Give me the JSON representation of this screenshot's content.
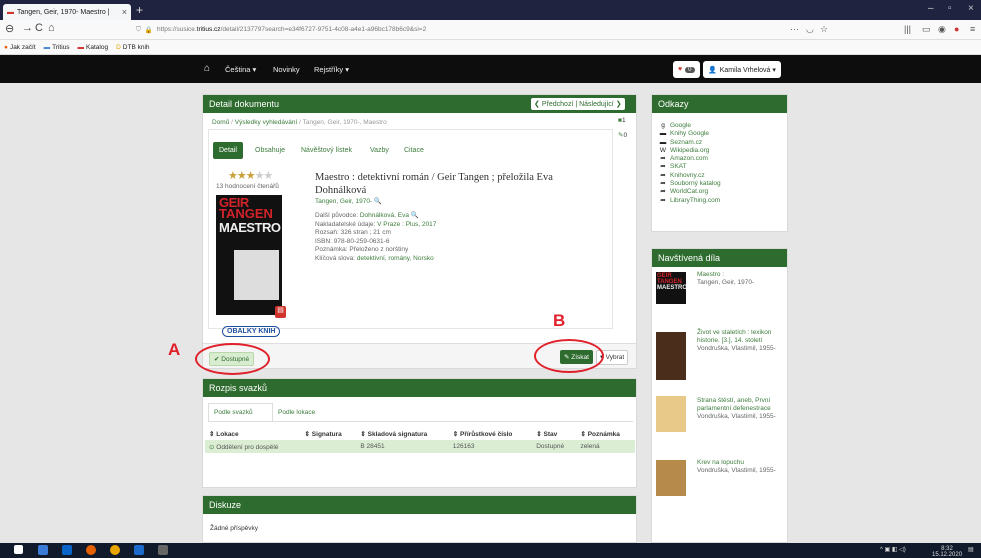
{
  "browser": {
    "tab_title": "Tangen, Geir, 1970- Maestro |",
    "url_prefix": "https://susice.",
    "url_domain": "tritius.cz",
    "url_path": "/detail/2137797search=e34f6727-9751-4c08-a4e1-a96bc178b6c9&si=2",
    "bookmarks": [
      "Jak začít",
      "Tritius",
      "Katalog",
      "DTB knih"
    ]
  },
  "topnav": {
    "lang": "Čeština ▾",
    "news": "Novinky",
    "registers": "Rejstříky ▾",
    "fav_count": "0",
    "user": "Kamila Vrhelová ▾"
  },
  "detail": {
    "header": "Detail dokumentu",
    "prev_next": "Předchozí | Následující",
    "breadcrumb": [
      "Domů",
      "Výsledky vyhledávání",
      "Tangen, Geir, 1970-, Maestro"
    ],
    "count_badge": "1",
    "edit_count": "0",
    "tabs": [
      "Detail",
      "Obsahuje",
      "Návěštový lístek",
      "Vazby",
      "Citace"
    ],
    "rating_text": "13 hodnocení čtenářů",
    "rating_stars": 3,
    "title": "Maestro : detektivní román / Geir Tangen ; přeložila Eva Dohnálková",
    "author": "Tangen, Geir, 1970-",
    "other_label": "Další původce: ",
    "other_value": "Dohnálková, Eva",
    "pub_label": "Nakladatelské údaje: ",
    "pub_value": "V Praze : Plus, 2017",
    "extent": "Rozsah: 326 stran ; 21 cm",
    "isbn": "ISBN: 978-80-259-0631-6",
    "note": "Poznámka: Přeloženo z norštiny",
    "kw_label": "Klíčová slova: ",
    "kw_value": "detektivní, romány, Norsko",
    "cover_lines": [
      "GEIR",
      "TANGEN",
      "MAESTRO"
    ],
    "obalky": "OBALKY KNIH",
    "available": "Dostupné",
    "get": "Získat",
    "choose": "Vybrat",
    "label_a": "A",
    "label_b": "B"
  },
  "volumes": {
    "header": "Rozpis svazků",
    "tabs": [
      "Podle svazků",
      "Podle lokace"
    ],
    "columns": [
      "Lokace",
      "Signatura",
      "Skladová signatura",
      "Přírůstkové číslo",
      "Stav",
      "Poznámka"
    ],
    "rows": [
      {
        "lokace": "Oddělení pro dospělé",
        "signatura": "",
        "sklad": "B 28451",
        "prir": "126163",
        "stav": "Dostupné",
        "pozn": "zelená"
      }
    ]
  },
  "discussion": {
    "header": "Diskuze",
    "empty": "Žádné příspěvky"
  },
  "links": {
    "header": "Odkazy",
    "items": [
      {
        "icon": "google-icon",
        "glyph": "g",
        "label": "Google"
      },
      {
        "icon": "book-icon",
        "glyph": "▬",
        "label": "Knihy Google"
      },
      {
        "icon": "book-icon",
        "glyph": "▬",
        "label": "Seznam.cz"
      },
      {
        "icon": "wikipedia-icon",
        "glyph": "W",
        "label": "Wikipedia.org"
      },
      {
        "icon": "arrow-icon",
        "glyph": "➦",
        "label": "Amazon.com"
      },
      {
        "icon": "arrow-icon",
        "glyph": "➦",
        "label": "SKAT"
      },
      {
        "icon": "arrow-icon",
        "glyph": "➦",
        "label": "Knihovny.cz"
      },
      {
        "icon": "arrow-icon",
        "glyph": "➦",
        "label": "Souborný katalog"
      },
      {
        "icon": "arrow-icon",
        "glyph": "➦",
        "label": "WorldCat.org"
      },
      {
        "icon": "arrow-icon",
        "glyph": "➦",
        "label": "LibraryThing.com"
      }
    ]
  },
  "visited": {
    "header": "Navštívená díla",
    "items": [
      {
        "title": "Maestro :",
        "author": "Tangen, Geir, 1970-"
      },
      {
        "title": "Život ve staletích : lexikon historie. [3.], 14. století",
        "author": "Vondruška, Vlastimil, 1955-"
      },
      {
        "title": "Strana štěstí, aneb, První parlamentní defenestrace",
        "author": "Vondruška, Vlastimil, 1955-"
      },
      {
        "title": "Krev na lopuchu",
        "author": "Vondruška, Vlastimil, 1955-"
      }
    ]
  },
  "taskbar": {
    "time": "8:32",
    "date": "15.12.2020"
  }
}
